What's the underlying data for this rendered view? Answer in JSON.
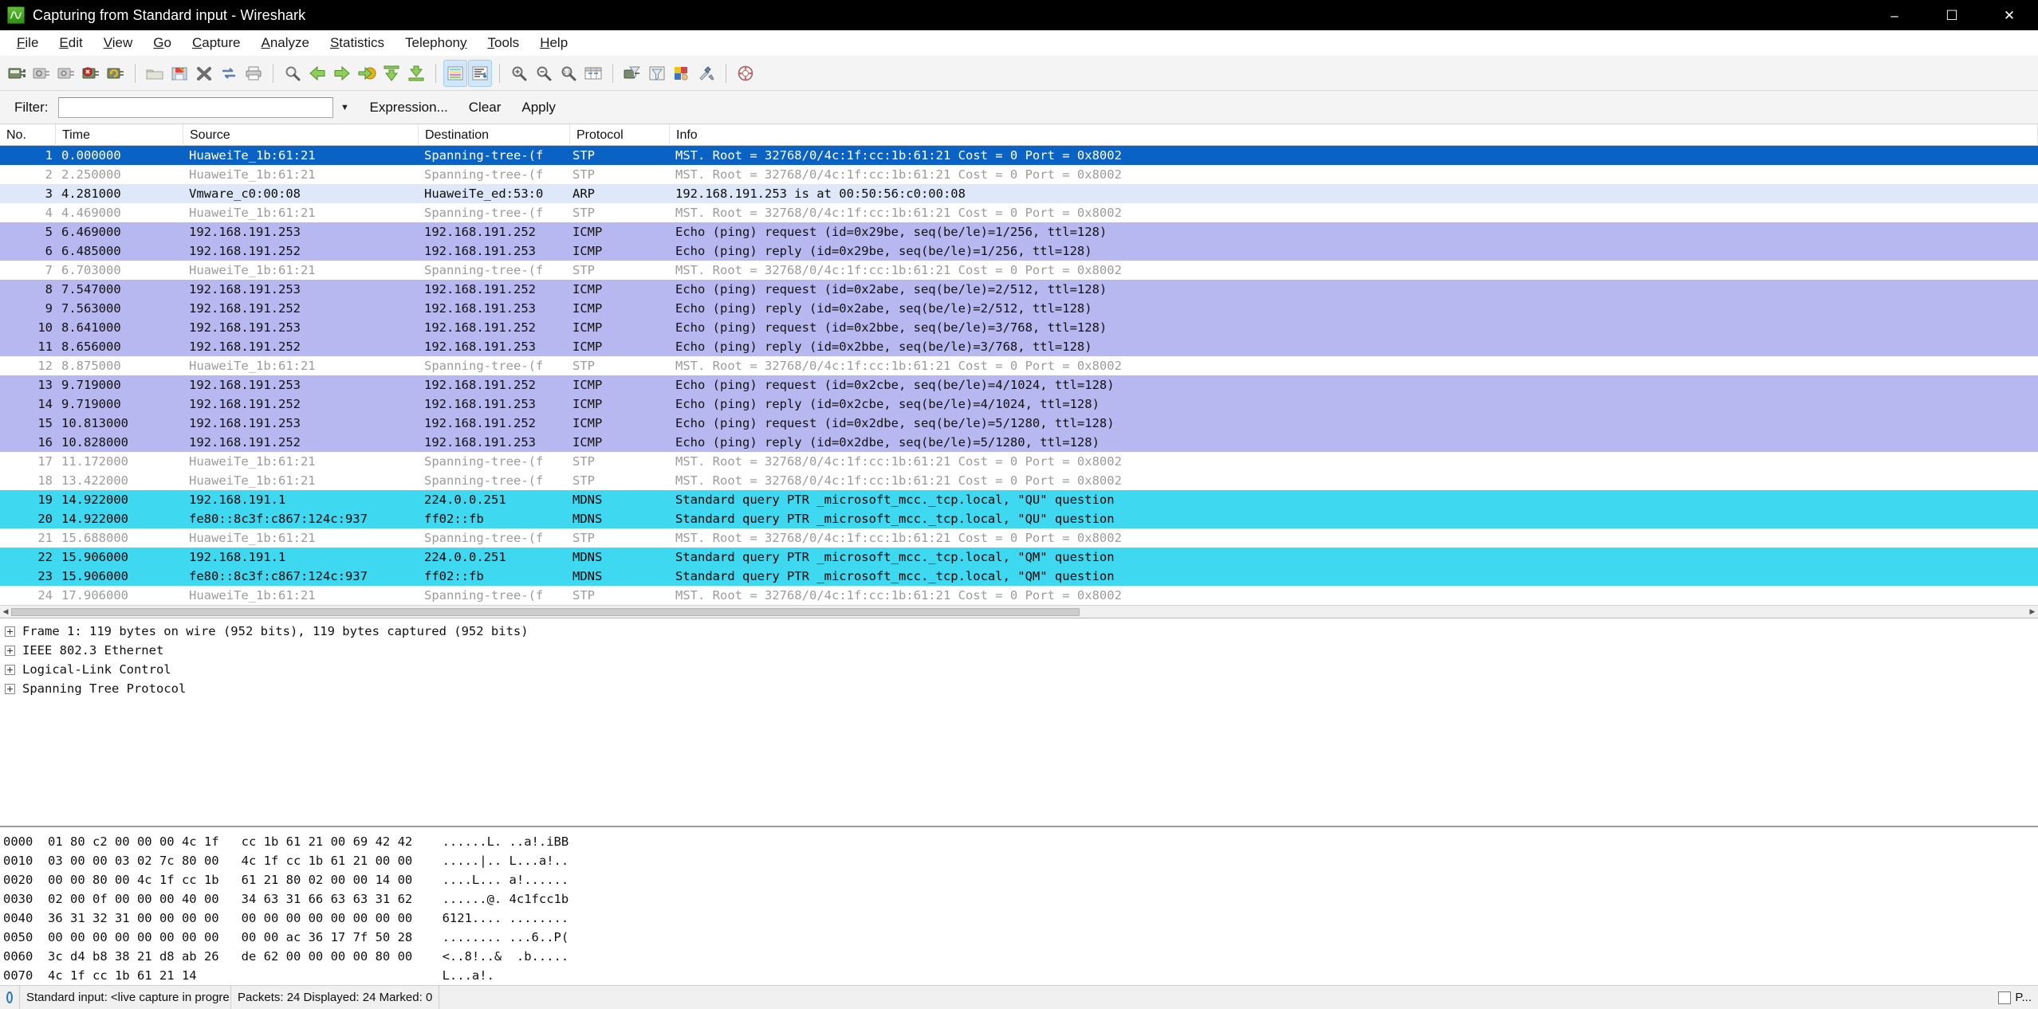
{
  "window": {
    "title": "Capturing from Standard input - Wireshark",
    "icon": "wireshark-icon",
    "minimize": "–",
    "maximize": "☐",
    "close": "✕"
  },
  "menubar": {
    "items": [
      {
        "name": "file",
        "pre": "",
        "accel": "F",
        "post": "ile"
      },
      {
        "name": "edit",
        "pre": "",
        "accel": "E",
        "post": "dit"
      },
      {
        "name": "view",
        "pre": "",
        "accel": "V",
        "post": "iew"
      },
      {
        "name": "go",
        "pre": "",
        "accel": "G",
        "post": "o"
      },
      {
        "name": "capture",
        "pre": "",
        "accel": "C",
        "post": "apture"
      },
      {
        "name": "analyze",
        "pre": "",
        "accel": "A",
        "post": "nalyze"
      },
      {
        "name": "statistics",
        "pre": "",
        "accel": "S",
        "post": "tatistics"
      },
      {
        "name": "telephony",
        "pre": "Telephon",
        "accel": "y",
        "post": ""
      },
      {
        "name": "tools",
        "pre": "",
        "accel": "T",
        "post": "ools"
      },
      {
        "name": "help",
        "pre": "",
        "accel": "H",
        "post": "elp"
      }
    ]
  },
  "toolbar": {
    "buttons": [
      {
        "name": "interfaces-icon",
        "tip": "List the available capture interfaces"
      },
      {
        "name": "capture-options-icon",
        "tip": "Show the capture options"
      },
      {
        "name": "start-capture-icon",
        "tip": "Start a new live capture"
      },
      {
        "name": "stop-capture-icon",
        "tip": "Stop the running live capture"
      },
      {
        "name": "restart-capture-icon",
        "tip": "Restart the running live capture"
      },
      {
        "name": "separator-1",
        "tip": ""
      },
      {
        "name": "open-file-icon",
        "tip": "Open a capture file"
      },
      {
        "name": "save-file-icon",
        "tip": "Save this capture file"
      },
      {
        "name": "close-file-icon",
        "tip": "Close this capture file"
      },
      {
        "name": "reload-file-icon",
        "tip": "Reload this capture file"
      },
      {
        "name": "print-icon",
        "tip": "Print packets"
      },
      {
        "name": "separator-2",
        "tip": ""
      },
      {
        "name": "find-packet-icon",
        "tip": "Find a packet"
      },
      {
        "name": "go-back-icon",
        "tip": "Go back in packet history"
      },
      {
        "name": "go-forward-icon",
        "tip": "Go forward in packet history"
      },
      {
        "name": "go-to-packet-icon",
        "tip": "Go to a specific packet"
      },
      {
        "name": "go-first-packet-icon",
        "tip": "Go to the first packet"
      },
      {
        "name": "go-last-packet-icon",
        "tip": "Go to the last packet"
      },
      {
        "name": "separator-3",
        "tip": ""
      },
      {
        "name": "colorize-toggle-icon",
        "tip": "Colorize packet list",
        "active": true
      },
      {
        "name": "autoscroll-toggle-icon",
        "tip": "Auto scroll in live capture",
        "active": true
      },
      {
        "name": "separator-4",
        "tip": ""
      },
      {
        "name": "zoom-in-icon",
        "tip": "Zoom in"
      },
      {
        "name": "zoom-out-icon",
        "tip": "Zoom out"
      },
      {
        "name": "zoom-reset-icon",
        "tip": "Normal size"
      },
      {
        "name": "resize-columns-icon",
        "tip": "Resize columns"
      },
      {
        "name": "separator-5",
        "tip": ""
      },
      {
        "name": "capture-filters-icon",
        "tip": "Edit capture filters"
      },
      {
        "name": "display-filters-icon",
        "tip": "Edit display filters"
      },
      {
        "name": "coloring-rules-icon",
        "tip": "Edit coloring rules"
      },
      {
        "name": "preferences-icon",
        "tip": "Edit preferences"
      },
      {
        "name": "separator-6",
        "tip": ""
      },
      {
        "name": "help-icon",
        "tip": "Show help"
      }
    ]
  },
  "filterbar": {
    "label": "Filter:",
    "value": "",
    "placeholder": "",
    "dropdown_icon": "chevron-down-icon",
    "expression_label": "Expression...",
    "clear_label": "Clear",
    "apply_label": "Apply"
  },
  "packet_list": {
    "columns": [
      "No.",
      "Time",
      "Source",
      "Destination",
      "Protocol",
      "Info"
    ],
    "rows": [
      {
        "no": "1",
        "time": "0.000000",
        "src": "HuaweiTe_1b:61:21",
        "dst": "Spanning-tree-(f",
        "prot": "STP",
        "info": "MST. Root = 32768/0/4c:1f:cc:1b:61:21  Cost = 0  Port = 0x8002",
        "style": "sel"
      },
      {
        "no": "2",
        "time": "2.250000",
        "src": "HuaweiTe_1b:61:21",
        "dst": "Spanning-tree-(f",
        "prot": "STP",
        "info": "MST. Root = 32768/0/4c:1f:cc:1b:61:21  Cost = 0  Port = 0x8002",
        "style": "stp"
      },
      {
        "no": "3",
        "time": "4.281000",
        "src": "Vmware_c0:00:08",
        "dst": "HuaweiTe_ed:53:0",
        "prot": "ARP",
        "info": "192.168.191.253 is at 00:50:56:c0:00:08",
        "style": "arp"
      },
      {
        "no": "4",
        "time": "4.469000",
        "src": "HuaweiTe_1b:61:21",
        "dst": "Spanning-tree-(f",
        "prot": "STP",
        "info": "MST. Root = 32768/0/4c:1f:cc:1b:61:21  Cost = 0  Port = 0x8002",
        "style": "stp"
      },
      {
        "no": "5",
        "time": "6.469000",
        "src": "192.168.191.253",
        "dst": "192.168.191.252",
        "prot": "ICMP",
        "info": "Echo (ping) request  (id=0x29be, seq(be/le)=1/256, ttl=128)",
        "style": "icmp"
      },
      {
        "no": "6",
        "time": "6.485000",
        "src": "192.168.191.252",
        "dst": "192.168.191.253",
        "prot": "ICMP",
        "info": "Echo (ping) reply    (id=0x29be, seq(be/le)=1/256, ttl=128)",
        "style": "icmp"
      },
      {
        "no": "7",
        "time": "6.703000",
        "src": "HuaweiTe_1b:61:21",
        "dst": "Spanning-tree-(f",
        "prot": "STP",
        "info": "MST. Root = 32768/0/4c:1f:cc:1b:61:21  Cost = 0  Port = 0x8002",
        "style": "stp"
      },
      {
        "no": "8",
        "time": "7.547000",
        "src": "192.168.191.253",
        "dst": "192.168.191.252",
        "prot": "ICMP",
        "info": "Echo (ping) request  (id=0x2abe, seq(be/le)=2/512, ttl=128)",
        "style": "icmp"
      },
      {
        "no": "9",
        "time": "7.563000",
        "src": "192.168.191.252",
        "dst": "192.168.191.253",
        "prot": "ICMP",
        "info": "Echo (ping) reply    (id=0x2abe, seq(be/le)=2/512, ttl=128)",
        "style": "icmp"
      },
      {
        "no": "10",
        "time": "8.641000",
        "src": "192.168.191.253",
        "dst": "192.168.191.252",
        "prot": "ICMP",
        "info": "Echo (ping) request  (id=0x2bbe, seq(be/le)=3/768, ttl=128)",
        "style": "icmp"
      },
      {
        "no": "11",
        "time": "8.656000",
        "src": "192.168.191.252",
        "dst": "192.168.191.253",
        "prot": "ICMP",
        "info": "Echo (ping) reply    (id=0x2bbe, seq(be/le)=3/768, ttl=128)",
        "style": "icmp"
      },
      {
        "no": "12",
        "time": "8.875000",
        "src": "HuaweiTe_1b:61:21",
        "dst": "Spanning-tree-(f",
        "prot": "STP",
        "info": "MST. Root = 32768/0/4c:1f:cc:1b:61:21  Cost = 0  Port = 0x8002",
        "style": "stp"
      },
      {
        "no": "13",
        "time": "9.719000",
        "src": "192.168.191.253",
        "dst": "192.168.191.252",
        "prot": "ICMP",
        "info": "Echo (ping) request  (id=0x2cbe, seq(be/le)=4/1024, ttl=128)",
        "style": "icmp"
      },
      {
        "no": "14",
        "time": "9.719000",
        "src": "192.168.191.252",
        "dst": "192.168.191.253",
        "prot": "ICMP",
        "info": "Echo (ping) reply    (id=0x2cbe, seq(be/le)=4/1024, ttl=128)",
        "style": "icmp"
      },
      {
        "no": "15",
        "time": "10.813000",
        "src": "192.168.191.253",
        "dst": "192.168.191.252",
        "prot": "ICMP",
        "info": "Echo (ping) request  (id=0x2dbe, seq(be/le)=5/1280, ttl=128)",
        "style": "icmp"
      },
      {
        "no": "16",
        "time": "10.828000",
        "src": "192.168.191.252",
        "dst": "192.168.191.253",
        "prot": "ICMP",
        "info": "Echo (ping) reply    (id=0x2dbe, seq(be/le)=5/1280, ttl=128)",
        "style": "icmp"
      },
      {
        "no": "17",
        "time": "11.172000",
        "src": "HuaweiTe_1b:61:21",
        "dst": "Spanning-tree-(f",
        "prot": "STP",
        "info": "MST. Root = 32768/0/4c:1f:cc:1b:61:21  Cost = 0  Port = 0x8002",
        "style": "stp"
      },
      {
        "no": "18",
        "time": "13.422000",
        "src": "HuaweiTe_1b:61:21",
        "dst": "Spanning-tree-(f",
        "prot": "STP",
        "info": "MST. Root = 32768/0/4c:1f:cc:1b:61:21  Cost = 0  Port = 0x8002",
        "style": "stp"
      },
      {
        "no": "19",
        "time": "14.922000",
        "src": "192.168.191.1",
        "dst": "224.0.0.251",
        "prot": "MDNS",
        "info": "Standard query PTR _microsoft_mcc._tcp.local, \"QU\" question",
        "style": "mdns"
      },
      {
        "no": "20",
        "time": "14.922000",
        "src": "fe80::8c3f:c867:124c:937",
        "dst": "ff02::fb",
        "prot": "MDNS",
        "info": "Standard query PTR _microsoft_mcc._tcp.local, \"QU\" question",
        "style": "mdns"
      },
      {
        "no": "21",
        "time": "15.688000",
        "src": "HuaweiTe_1b:61:21",
        "dst": "Spanning-tree-(f",
        "prot": "STP",
        "info": "MST. Root = 32768/0/4c:1f:cc:1b:61:21  Cost = 0  Port = 0x8002",
        "style": "stp"
      },
      {
        "no": "22",
        "time": "15.906000",
        "src": "192.168.191.1",
        "dst": "224.0.0.251",
        "prot": "MDNS",
        "info": "Standard query PTR _microsoft_mcc._tcp.local, \"QM\" question",
        "style": "mdns"
      },
      {
        "no": "23",
        "time": "15.906000",
        "src": "fe80::8c3f:c867:124c:937",
        "dst": "ff02::fb",
        "prot": "MDNS",
        "info": "Standard query PTR _microsoft_mcc._tcp.local, \"QM\" question",
        "style": "mdns"
      },
      {
        "no": "24",
        "time": "17.906000",
        "src": "HuaweiTe_1b:61:21",
        "dst": "Spanning-tree-(f",
        "prot": "STP",
        "info": "MST. Root = 32768/0/4c:1f:cc:1b:61:21  Cost = 0  Port = 0x8002",
        "style": "stp"
      }
    ]
  },
  "detail_pane": {
    "nodes": [
      "Frame 1: 119 bytes on wire (952 bits), 119 bytes captured (952 bits)",
      "IEEE 802.3 Ethernet",
      "Logical-Link Control",
      "Spanning Tree Protocol"
    ]
  },
  "bytes_pane": {
    "lines": [
      {
        "offset": "0000",
        "hex1": "01 80 c2 00 00 00 4c 1f",
        "hex2": "cc 1b 61 21 00 69 42 42",
        "ascii1": "......L.",
        "ascii2": "..a!.iBB"
      },
      {
        "offset": "0010",
        "hex1": "03 00 00 03 02 7c 80 00",
        "hex2": "4c 1f cc 1b 61 21 00 00",
        "ascii1": ".....|..",
        "ascii2": "L...a!.."
      },
      {
        "offset": "0020",
        "hex1": "00 00 80 00 4c 1f cc 1b",
        "hex2": "61 21 80 02 00 00 14 00",
        "ascii1": "....L...",
        "ascii2": "a!......"
      },
      {
        "offset": "0030",
        "hex1": "02 00 0f 00 00 00 40 00",
        "hex2": "34 63 31 66 63 63 31 62",
        "ascii1": "......@.",
        "ascii2": "4c1fcc1b"
      },
      {
        "offset": "0040",
        "hex1": "36 31 32 31 00 00 00 00",
        "hex2": "00 00 00 00 00 00 00 00",
        "ascii1": "6121....",
        "ascii2": "........"
      },
      {
        "offset": "0050",
        "hex1": "00 00 00 00 00 00 00 00",
        "hex2": "00 00 ac 36 17 7f 50 28",
        "ascii1": "........",
        "ascii2": "...6..P("
      },
      {
        "offset": "0060",
        "hex1": "3c d4 b8 38 21 d8 ab 26",
        "hex2": "de 62 00 00 00 00 80 00",
        "ascii1": "<..8!..&",
        "ascii2": " .b....."
      },
      {
        "offset": "0070",
        "hex1": "4c 1f cc 1b 61 21 14",
        "hex2": "",
        "ascii1": "L...a!.",
        "ascii2": ""
      }
    ]
  },
  "statusbar": {
    "ready_icon": "capture-status-icon",
    "capture_source": "Standard input: <live capture in progre...",
    "packet_counts": "Packets: 24 Displayed: 24 Marked: 0",
    "profile": "P..."
  },
  "colors": {
    "selected_row": "#0a62c4",
    "icmp_row": "#b8b8f0",
    "mdns_row": "#3ed8f0",
    "arp_row": "#dfe8f8",
    "stp_text": "#9c9c9c",
    "titlebar": "#000000"
  }
}
